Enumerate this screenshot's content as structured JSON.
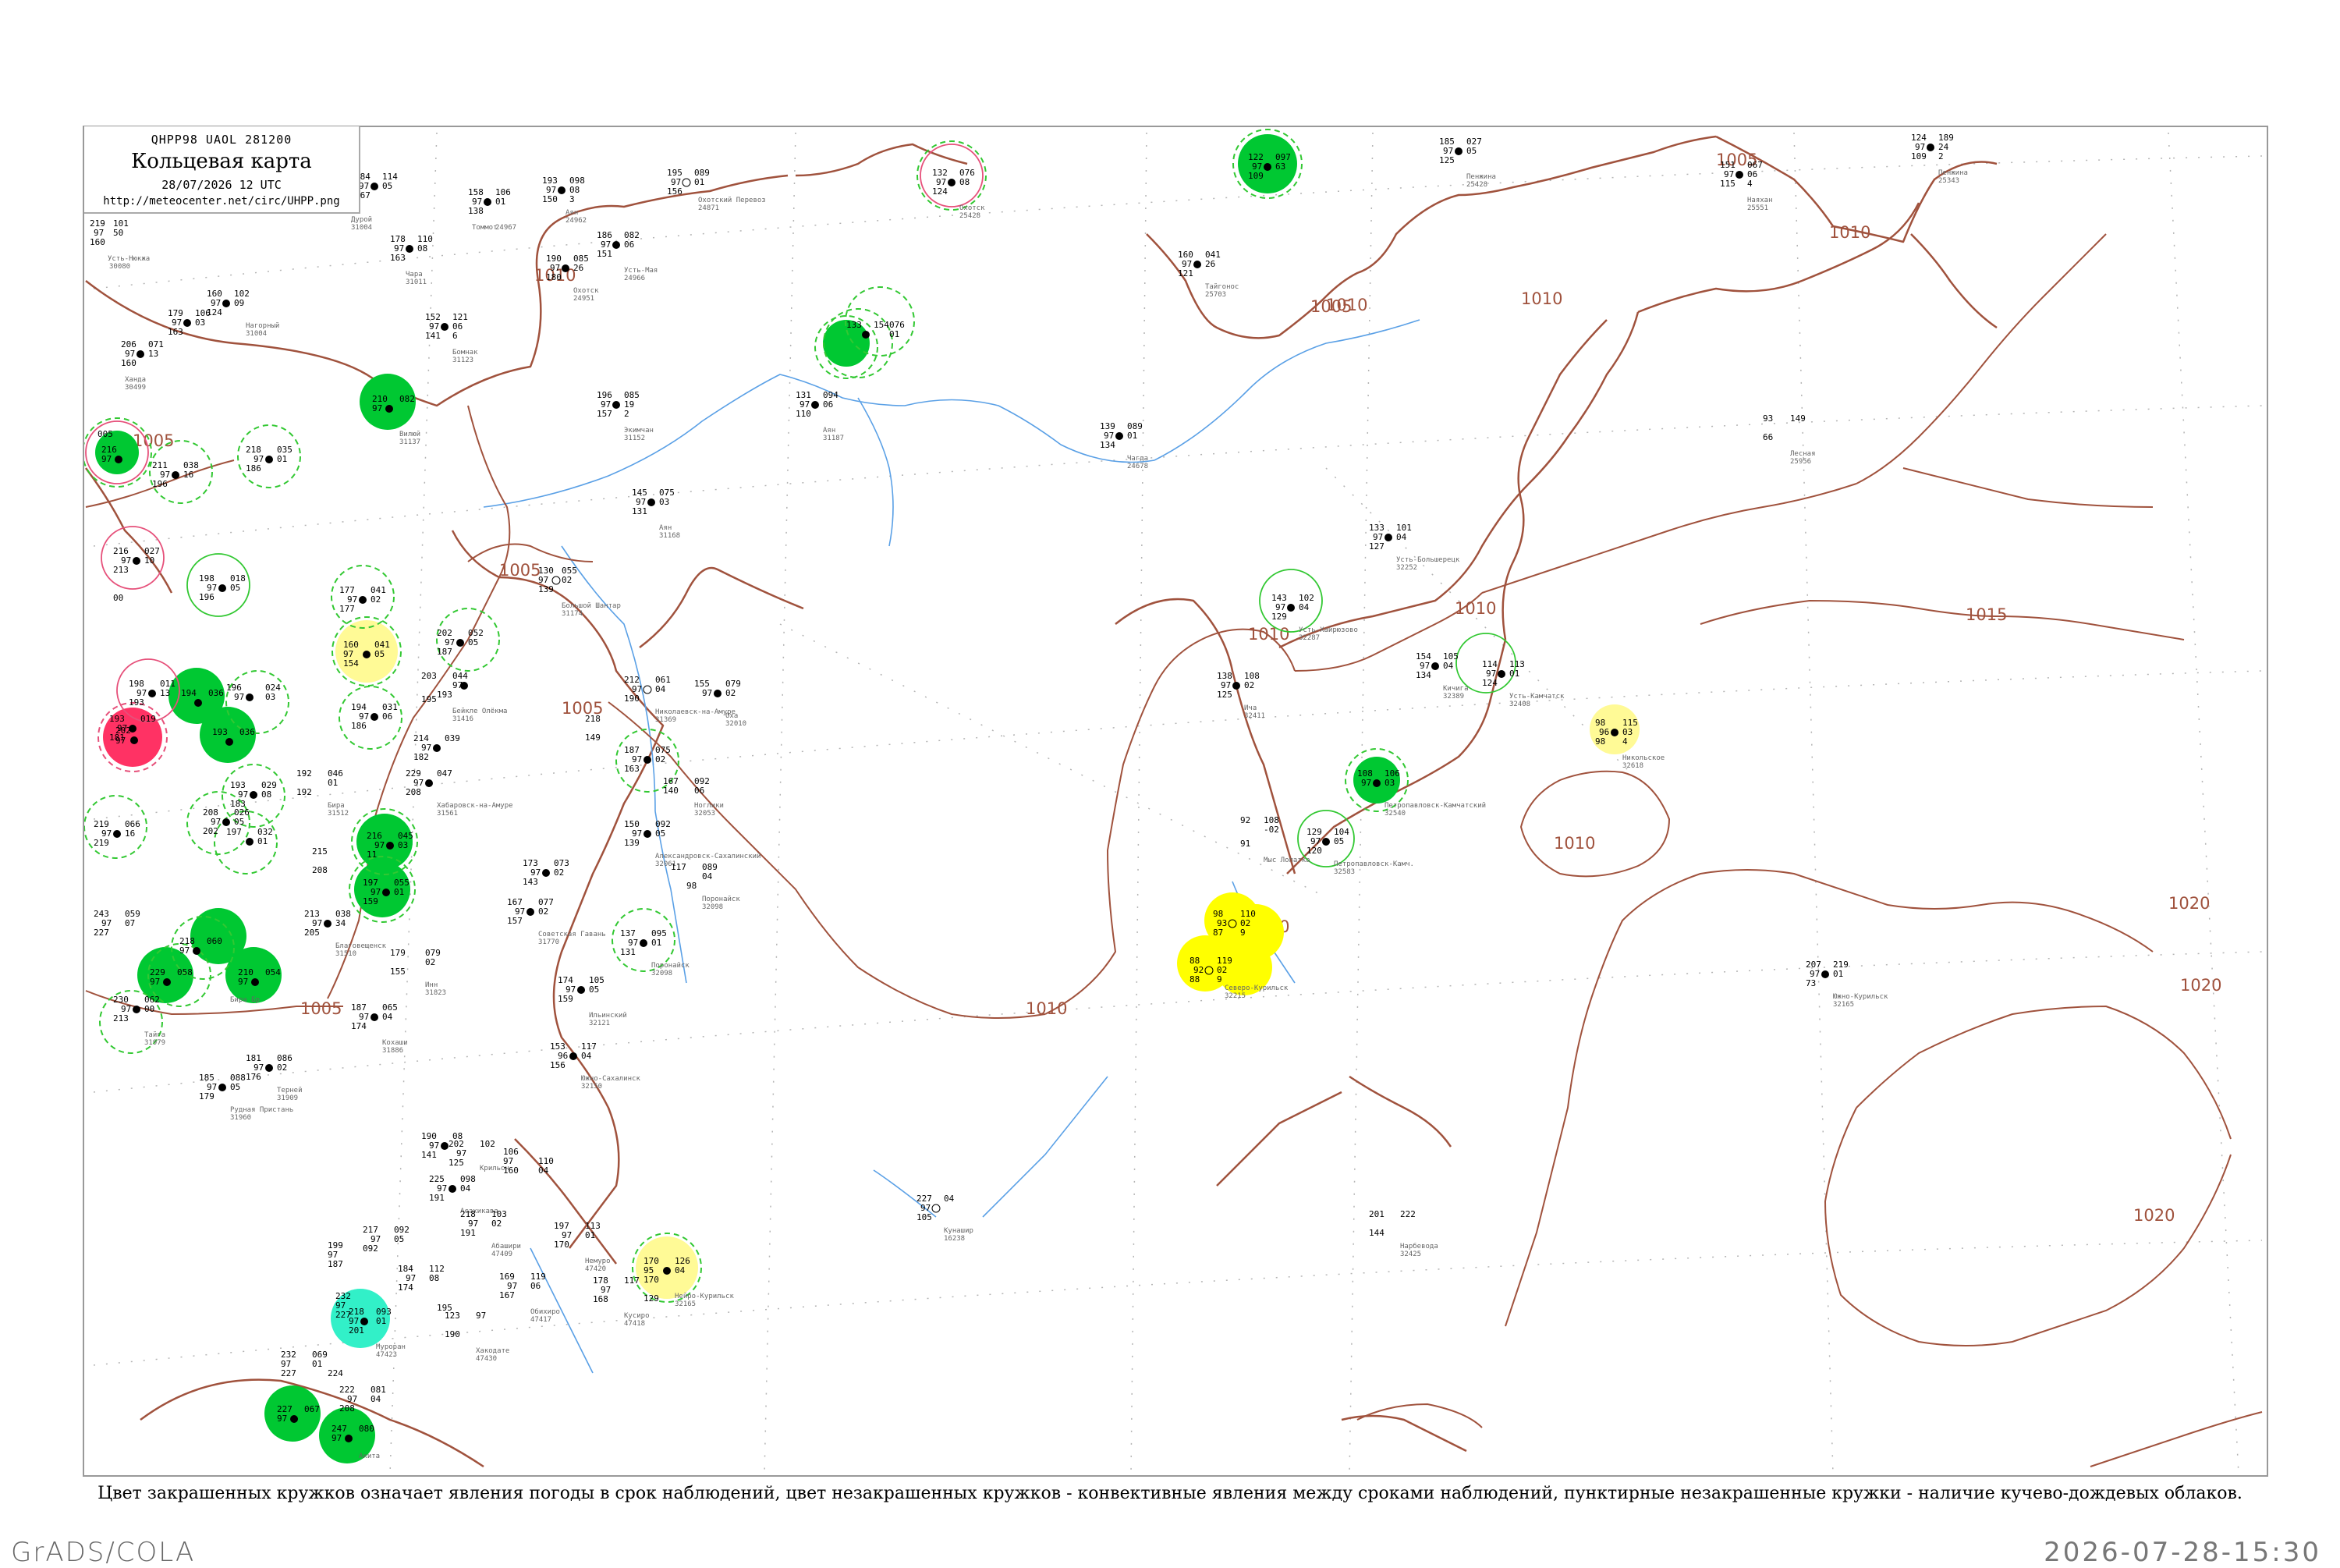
{
  "header": {
    "code_line": "QHPP98  UAOL  281200",
    "title": "Кольцевая карта",
    "datetime": "28/07/2026 12 UTC",
    "url": "http://meteocenter.net/circ/UHPP.png"
  },
  "caption": "Цвет закрашенных кружков означает явления погоды в срок наблюдений, цвет незакрашенных кружков - конвективные явления между сроками наблюдений, пунктирные незакрашенные кружки - наличие кучево-дождевых облаков.",
  "footer": {
    "left": "GrADS/COLA",
    "right": "2026-07-28-15:30"
  },
  "colors": {
    "isobar": "#a0523d",
    "river": "#5aa0e6",
    "grid": "#b4b4b4",
    "frame": "#999999",
    "rain_green": "#00c832",
    "fog_yellow": "#ffff00",
    "haze_yellow": "#fffa96",
    "thunder_red": "#ff3264",
    "snow_cyan": "#32f0c8",
    "cb_dashed_green": "#32c832",
    "cb_red": "#e6507a"
  },
  "isobars": [
    {
      "label": "1005"
    },
    {
      "label": "1010"
    },
    {
      "label": "1015"
    },
    {
      "label": "1020"
    }
  ],
  "isobar_labels": [
    "1005",
    "1005",
    "1005",
    "1005",
    "1005",
    "1005",
    "1010",
    "1010",
    "1010",
    "1010",
    "1010",
    "1010",
    "1010",
    "1010",
    "1010",
    "1015",
    "1020",
    "1020",
    "1020"
  ],
  "stations": [
    {
      "name": "Усть-Нюкжа",
      "num": "219",
      "id": "30080"
    },
    {
      "name": "Дурой",
      "num": "184",
      "id": "31004"
    },
    {
      "name": "Чара",
      "num": "178",
      "id": "31011"
    },
    {
      "name": "Томмот",
      "num": "158",
      "id": "31026"
    },
    {
      "name": "Аян",
      "num": "193",
      "id": "31149"
    },
    {
      "name": "Охотск",
      "num": "195",
      "id": "31088"
    },
    {
      "name": "Пенжина",
      "num": "185",
      "id": "25551"
    },
    {
      "name": "Наяхан",
      "num": "151",
      "id": "25551"
    },
    {
      "name": "Кичига",
      "num": "124",
      "id": "32389"
    },
    {
      "name": "Усть-Большерецк",
      "num": "133",
      "id": "32252"
    },
    {
      "name": "Петропавловск-Камчатский",
      "num": "113",
      "id": "32540"
    },
    {
      "name": "Никольское",
      "num": "115",
      "id": "32618"
    },
    {
      "name": "Северо-Курильск",
      "num": "119",
      "id": "32215"
    },
    {
      "name": "Южно-Курильск",
      "num": "221",
      "id": "32165"
    },
    {
      "name": "Николаевск-на-Амуре",
      "num": "212",
      "id": "31369"
    },
    {
      "name": "Александровск-Сахалинский",
      "num": "150",
      "id": "32061"
    },
    {
      "name": "Поронайск",
      "num": "117",
      "id": "32098"
    },
    {
      "name": "Южно-Сахалинск",
      "num": "153",
      "id": "32150"
    },
    {
      "name": "Советская Гавань",
      "num": "173",
      "id": "31770"
    },
    {
      "name": "Хабаровск",
      "num": "213",
      "id": "31735"
    },
    {
      "name": "Благовещенск",
      "num": "205",
      "id": "31510"
    },
    {
      "name": "Владивосток",
      "num": "199",
      "id": "31960"
    },
    {
      "name": "Вакканай",
      "num": "170",
      "id": "47401"
    },
    {
      "name": "Сапporo",
      "num": "202",
      "id": "47412"
    },
    {
      "name": "Хакодате",
      "num": "217",
      "id": "47430"
    },
    {
      "name": "Мисава",
      "num": "232",
      "id": "47580"
    },
    {
      "name": "Акита",
      "num": "222",
      "id": "47582"
    }
  ],
  "weather_circles": [
    {
      "type": "rain",
      "fill": "#00c832"
    },
    {
      "type": "fog",
      "fill": "#ffff00"
    },
    {
      "type": "haze",
      "fill": "#fffa96"
    },
    {
      "type": "thunderstorm",
      "fill": "#ff3264"
    },
    {
      "type": "shower-snow",
      "fill": "#32f0c8"
    }
  ]
}
